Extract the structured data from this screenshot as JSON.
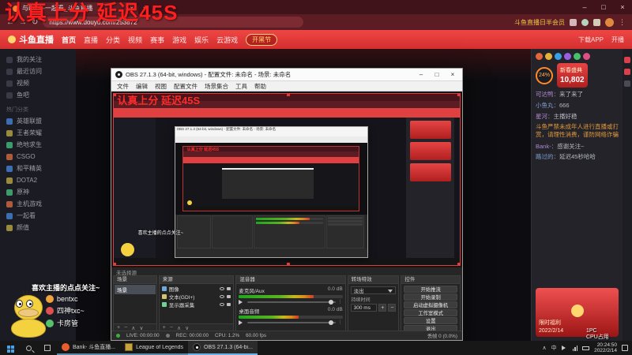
{
  "overlay": {
    "title": "认真上分 延迟45S",
    "stats_line1": "1PC",
    "stats_line2": "CPU占用"
  },
  "browser": {
    "tab_title": "与Bank-一起看_斗鱼直播",
    "url": "https://www.douyu.com/253872",
    "note": "斗鱼直播日半会员"
  },
  "site": {
    "logo": "斗鱼直播",
    "nav": [
      "首页",
      "直播",
      "分类",
      "视频",
      "赛事",
      "游戏",
      "娱乐",
      "云游戏"
    ],
    "promo": "开黑节",
    "download": "下载APP",
    "golive": "开播"
  },
  "sidebar": {
    "top_items": [
      "我的关注",
      "最近访问",
      "视频",
      "鱼吧"
    ],
    "section_title": "热门分类",
    "categories": [
      "英雄联盟",
      "王者荣耀",
      "绝地求生",
      "CSGO",
      "和平精英",
      "DOTA2",
      "原神",
      "主机游戏",
      "一起看",
      "颜值"
    ]
  },
  "chat": {
    "badge": "24%",
    "messages": [
      {
        "user": "可达鸭",
        "text": "来了来了"
      },
      {
        "user": "小鱼丸",
        "text": "666"
      },
      {
        "user": "星河",
        "text": "主播好稳"
      },
      {
        "user": "Bank-",
        "text": "感谢关注~"
      },
      {
        "user": "路过的",
        "text": "延迟45秒哈哈"
      }
    ],
    "notice": "斗鱼严禁未成年人进行直播或打赏，请理性消费，谨防网络诈骗",
    "activity_title": "新春盛典",
    "activity_value": "10,802",
    "promo_title": "限时福利",
    "promo_date": "2022/2/14"
  },
  "mascot": {
    "follow": "喜欢主播的点点关注~",
    "fans": [
      "bentxc",
      "四神txc~",
      "卡房管"
    ]
  },
  "obs": {
    "title": "OBS 27.1.3 (64-bit, windows) - 配置文件: 未命名 - 场景: 未命名",
    "menus": [
      "文件",
      "编辑",
      "视图",
      "配置文件",
      "场景集合",
      "工具",
      "帮助"
    ],
    "no_source": "未选择源",
    "dock_scenes": "场景",
    "dock_sources": "来源",
    "dock_mixer": "混音器",
    "dock_transitions": "转场特效",
    "dock_controls": "控件",
    "scene_item": "场景",
    "sources": [
      "图像",
      "文本(GDI+)",
      "显示器采集"
    ],
    "mixer_ch1_name": "麦克风/Aux",
    "mixer_ch1_db": "0.0 dB",
    "mixer_ch2_name": "桌面音频",
    "mixer_ch2_db": "0.0 dB",
    "transition_type": "淡出",
    "duration_label": "持续时间",
    "duration_value": "300 ms",
    "controls": [
      "开始推流",
      "开始录制",
      "启动虚拟摄像机",
      "工作室模式",
      "设置",
      "退出"
    ],
    "status_live": "LIVE: 00:00:00",
    "status_rec": "REC: 00:00:00",
    "status_cpu": "CPU: 1.2%",
    "status_fps": "60.00 fps",
    "status_dropped": "丢帧 0 (0.0%)"
  },
  "taskbar": {
    "apps": [
      "Bank- 斗鱼直播...",
      "League of Legends",
      "OBS 27.1.3 (64-bi..."
    ],
    "input": "中",
    "time": "20:24:50",
    "date": "2022/2/14"
  }
}
